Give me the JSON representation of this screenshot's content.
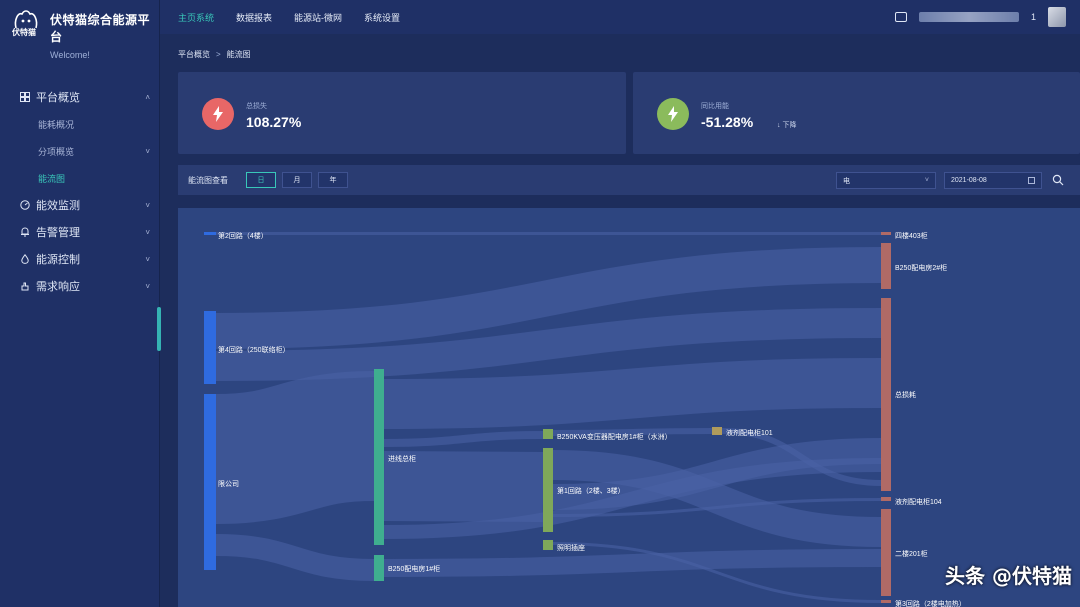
{
  "app": {
    "title": "伏特猫综合能源平台",
    "subtitle": "Welcome!",
    "brand": "伏特猫"
  },
  "topnav": [
    "主页系统",
    "数据报表",
    "能源站-微网",
    "系统设置"
  ],
  "user": {
    "name_suffix": "1"
  },
  "sidebar": {
    "items": [
      {
        "label": "平台概览",
        "chevron": "˄",
        "icon": "grid-icon"
      },
      {
        "label": "能效监测",
        "chevron": "˅",
        "icon": "gauge-icon"
      },
      {
        "label": "告警管理",
        "chevron": "˅",
        "icon": "bell-icon"
      },
      {
        "label": "能源控制",
        "chevron": "˅",
        "icon": "drop-icon"
      },
      {
        "label": "需求响应",
        "chevron": "˅",
        "icon": "hand-icon"
      }
    ],
    "subitems": [
      {
        "label": "能耗概况"
      },
      {
        "label": "分项概览",
        "chevron": "˅"
      },
      {
        "label": "能流图"
      }
    ]
  },
  "breadcrumb": {
    "root": "平台概览",
    "sep": ">",
    "current": "能流图"
  },
  "cards": [
    {
      "label": "总损失",
      "value": "108.27%",
      "color": "#e86767"
    },
    {
      "label": "同比用能",
      "value": "-51.28%",
      "trend": "↓ 下降",
      "color": "#8bbb5c"
    }
  ],
  "filter": {
    "label": "能流图查看",
    "periods": [
      "日",
      "月",
      "年"
    ],
    "active_period": "日",
    "energy_type": "电",
    "date": "2021-08-08"
  },
  "chart_data": {
    "type": "sankey",
    "nodes": [
      {
        "id": "n1",
        "label": "第2回路（4楼）"
      },
      {
        "id": "n2",
        "label": "第4回路（250联络柜）"
      },
      {
        "id": "n3",
        "label": "限公司"
      },
      {
        "id": "n4",
        "label": "进线总柜"
      },
      {
        "id": "n5",
        "label": "B250配电房1#柜"
      },
      {
        "id": "n6",
        "label": "B250KVA变压器配电房1#柜（水洲）"
      },
      {
        "id": "n7",
        "label": "第1回路（2楼、3楼）"
      },
      {
        "id": "n8",
        "label": "照明插座"
      },
      {
        "id": "n9",
        "label": "液剂配电柜101"
      },
      {
        "id": "n10",
        "label": "四楼403柜"
      },
      {
        "id": "n11",
        "label": "B250配电房2#柜"
      },
      {
        "id": "n12",
        "label": "总损耗"
      },
      {
        "id": "n13",
        "label": "液剂配电柜104"
      },
      {
        "id": "n14",
        "label": "二楼201柜"
      },
      {
        "id": "n15",
        "label": "第3回路（2楼电加热）"
      }
    ],
    "colors": {
      "source": "#2f6be0",
      "mid": "#3fae8f",
      "green": "#7fa85a",
      "tan": "#b09b5c",
      "sink": "#b06a66",
      "link": "#4a63a5"
    }
  }
}
